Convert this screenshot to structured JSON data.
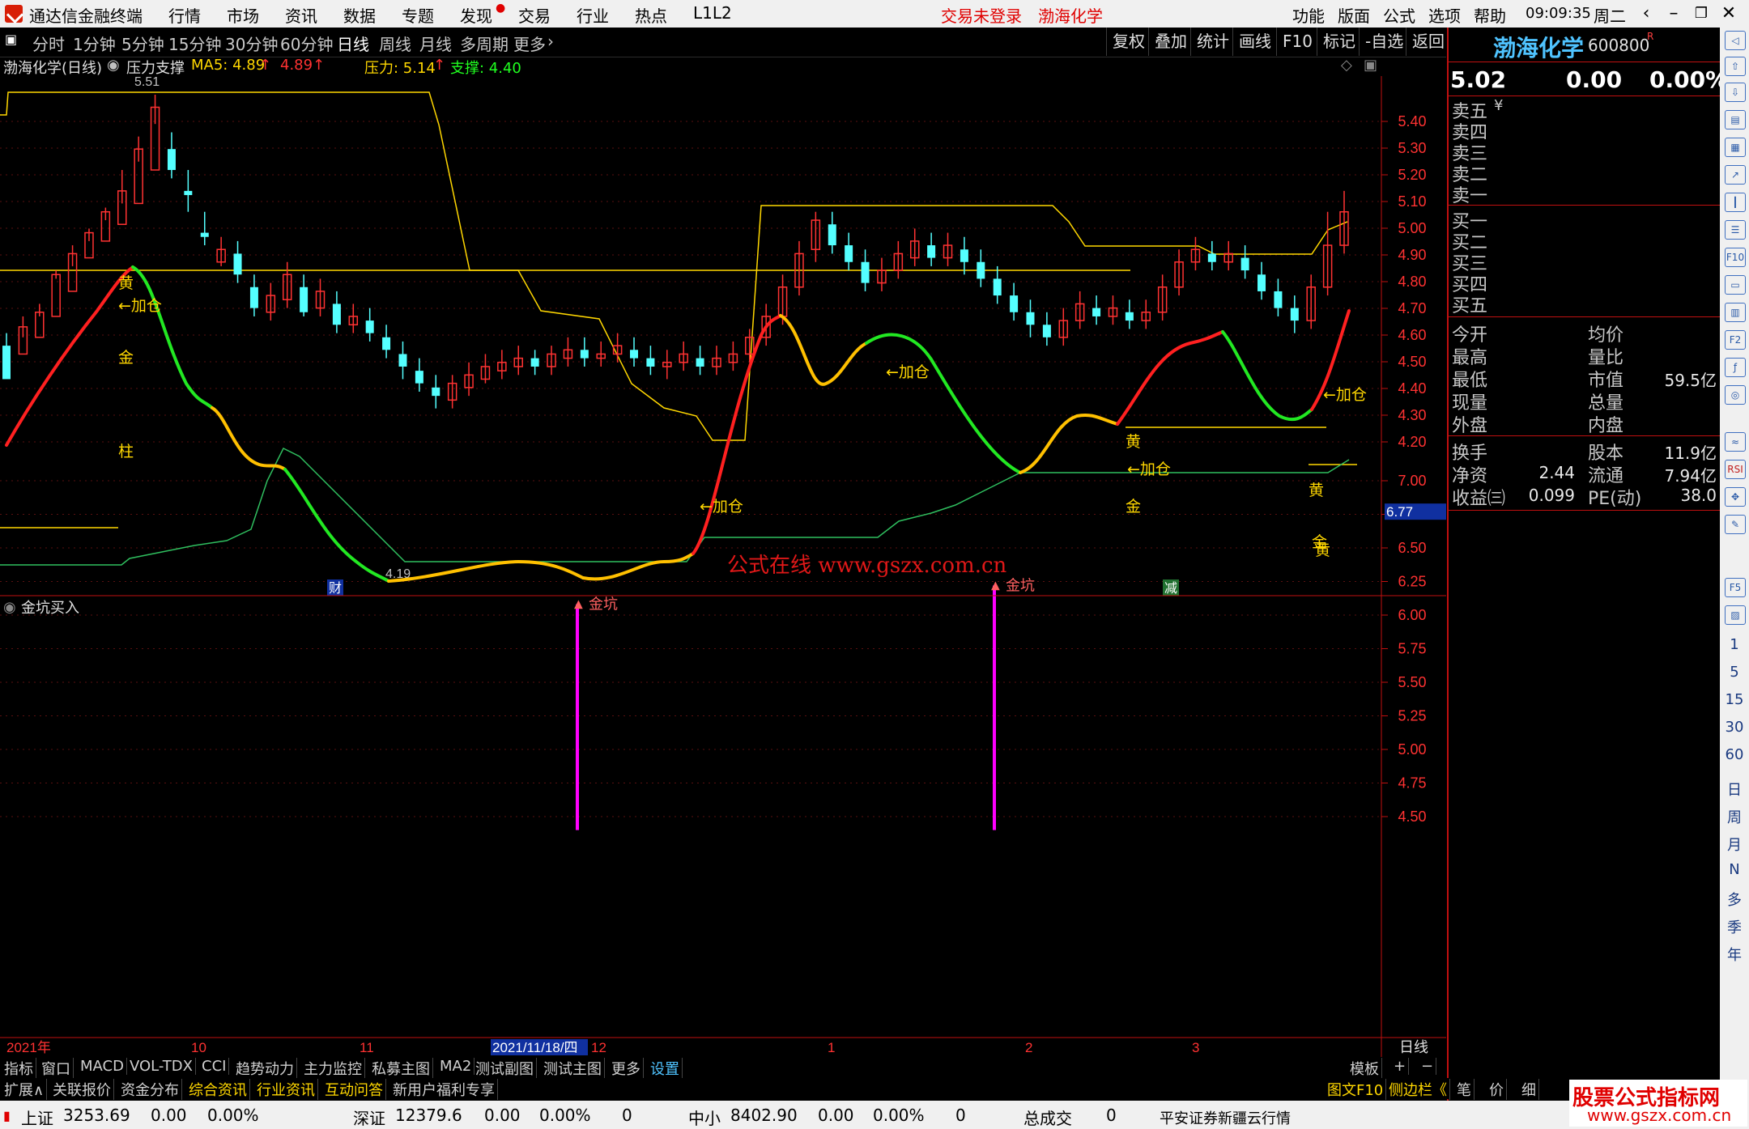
{
  "app": {
    "title": "通达信金融终端",
    "menu": [
      "行情",
      "市场",
      "资讯",
      "数据",
      "专题",
      "发现",
      "交易",
      "行业",
      "热点",
      "L1L2"
    ],
    "login_status": "交易未登录",
    "stock_name_top": "渤海化学",
    "right_menu": [
      "功能",
      "版面",
      "公式",
      "选项",
      "帮助"
    ],
    "clock": "09:09:35",
    "weekday": "周二"
  },
  "period_tabs": [
    "分时",
    "1分钟",
    "5分钟",
    "15分钟",
    "30分钟",
    "60分钟",
    "日线",
    "周线",
    "月线",
    "多周期",
    "更多"
  ],
  "active_tab": "日线",
  "right_tabs": [
    "复权",
    "叠加",
    "统计",
    "画线",
    "F10",
    "标记",
    "-自选",
    "返回"
  ],
  "info_line": {
    "stock": "渤海化学(日线)",
    "indicator": "压力支撑",
    "ma5_label": "MA5: 4.89",
    "ma5_arrow": "↑",
    "ma5_val2": "4.89",
    "ma5_arrow2": "↑",
    "pressure": "压力: 5.14",
    "pressure_arrow": "↑",
    "support": "支撑: 4.40"
  },
  "main_chart": {
    "y_ticks": [
      "5.40",
      "5.30",
      "5.20",
      "5.10",
      "5.00",
      "4.90",
      "4.80",
      "4.70",
      "4.60",
      "4.50",
      "4.40",
      "4.30",
      "4.20"
    ],
    "high_label": "5.51",
    "low_label": "4.19",
    "annotations": [
      "黄",
      "←加仓",
      "金",
      "柱",
      "←加仓",
      "←加仓",
      "黄",
      "←加仓",
      "金",
      "黄",
      "←加仓",
      "黄",
      "金"
    ],
    "markers": [
      "财",
      "减"
    ],
    "watermark": "公式在线  www.gszx.com.cn"
  },
  "sub_chart": {
    "title": "金坑买入",
    "y_ticks": [
      "7.00",
      "6.75",
      "6.50",
      "6.25",
      "6.00",
      "5.75",
      "5.50",
      "5.25",
      "5.00",
      "4.75",
      "4.50"
    ],
    "current": "6.77",
    "signal_label": "金坑"
  },
  "x_axis": {
    "labels": [
      "2021年",
      "10",
      "11",
      "2021/11/18/四",
      "12",
      "1",
      "2",
      "3"
    ],
    "period": "日线"
  },
  "bottom_tabs": [
    "指标",
    "窗口",
    "MACD",
    "VOL-TDX",
    "CCI",
    "趋势动力",
    "主力监控",
    "私募主图",
    "MA2",
    "测试副图",
    "测试主图",
    "更多",
    "设置"
  ],
  "bottom_right": [
    "模板",
    "+",
    "−"
  ],
  "bottom_tabs2": [
    "扩展∧",
    "关联报价",
    "资金分布",
    "综合资讯",
    "行业资讯",
    "互动问答",
    "新用户福利专享"
  ],
  "bottom_tabs2_right": [
    "图文F10",
    "侧边栏《",
    "笔",
    "价",
    "细"
  ],
  "right_panel": {
    "name": "渤海化学",
    "code": "600800",
    "code_badge": "R",
    "price": "5.02",
    "change": "0.00",
    "change_pct": "0.00%",
    "sell": [
      "卖五",
      "卖四",
      "卖三",
      "卖二",
      "卖一"
    ],
    "sell_unit": "¥",
    "buy": [
      "买一",
      "买二",
      "买三",
      "买四",
      "买五"
    ],
    "stats_left": [
      "今开",
      "最高",
      "最低",
      "现量",
      "外盘"
    ],
    "stats_right": [
      "均价",
      "量比",
      "市值",
      "总量",
      "内盘"
    ],
    "market_cap": "59.5亿",
    "detail": [
      {
        "l": "换手",
        "lv": "",
        "r": "股本",
        "rv": "11.9亿"
      },
      {
        "l": "净资",
        "lv": "2.44",
        "r": "流通",
        "rv": "7.94亿"
      },
      {
        "l": "收益㈢",
        "lv": "0.099",
        "r": "PE(动)",
        "rv": "38.0"
      }
    ]
  },
  "right_sidebar": [
    "1",
    "5",
    "15",
    "30",
    "60",
    "日",
    "周",
    "月",
    "N",
    "多",
    "季",
    "年"
  ],
  "status_bar": {
    "sh": "上证",
    "sh_val": "3253.69",
    "sh_chg": "0.00",
    "sh_pct": "0.00%",
    "sz": "深证",
    "sz_val": "12379.6",
    "sz_chg": "0.00",
    "sz_pct": "0.00%",
    "sz_vol": "0",
    "zx": "中小",
    "zx_val": "8402.90",
    "zx_chg": "0.00",
    "zx_pct": "0.00%",
    "zx_vol": "0",
    "total": "总成交",
    "total_val": "0",
    "broker": "平安证券新疆云行情"
  },
  "corner_watermark": {
    "line1": "股票公式指标网",
    "line2": "www.gszx.com.cn"
  },
  "colors": {
    "up": "#ff3232",
    "down": "#54ffff",
    "yellow": "#ffd700",
    "axis": "#c01010",
    "magenta": "#ff00ff"
  }
}
